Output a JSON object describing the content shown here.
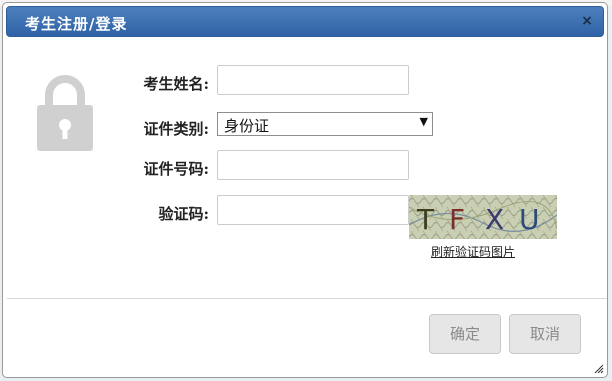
{
  "dialog": {
    "title": "考生注册/登录",
    "close_symbol": "×"
  },
  "form": {
    "name_label": "考生姓名:",
    "name_value": "",
    "id_type_label": "证件类别:",
    "id_type_selected": "身份证",
    "id_number_label": "证件号码:",
    "id_number_value": "",
    "captcha_label": "验证码:",
    "captcha_value": "",
    "captcha_text": "TFXU",
    "captcha_refresh": "刷新验证码图片"
  },
  "buttons": {
    "confirm": "确定",
    "cancel": "取消"
  },
  "icons": {
    "lock": "lock-icon",
    "close": "close-icon",
    "dropdown": "chevron-down-icon"
  },
  "colors": {
    "titlebar": "#3a6eae",
    "lock": "#d0d0d0",
    "button_bg": "#e6e6e6"
  }
}
